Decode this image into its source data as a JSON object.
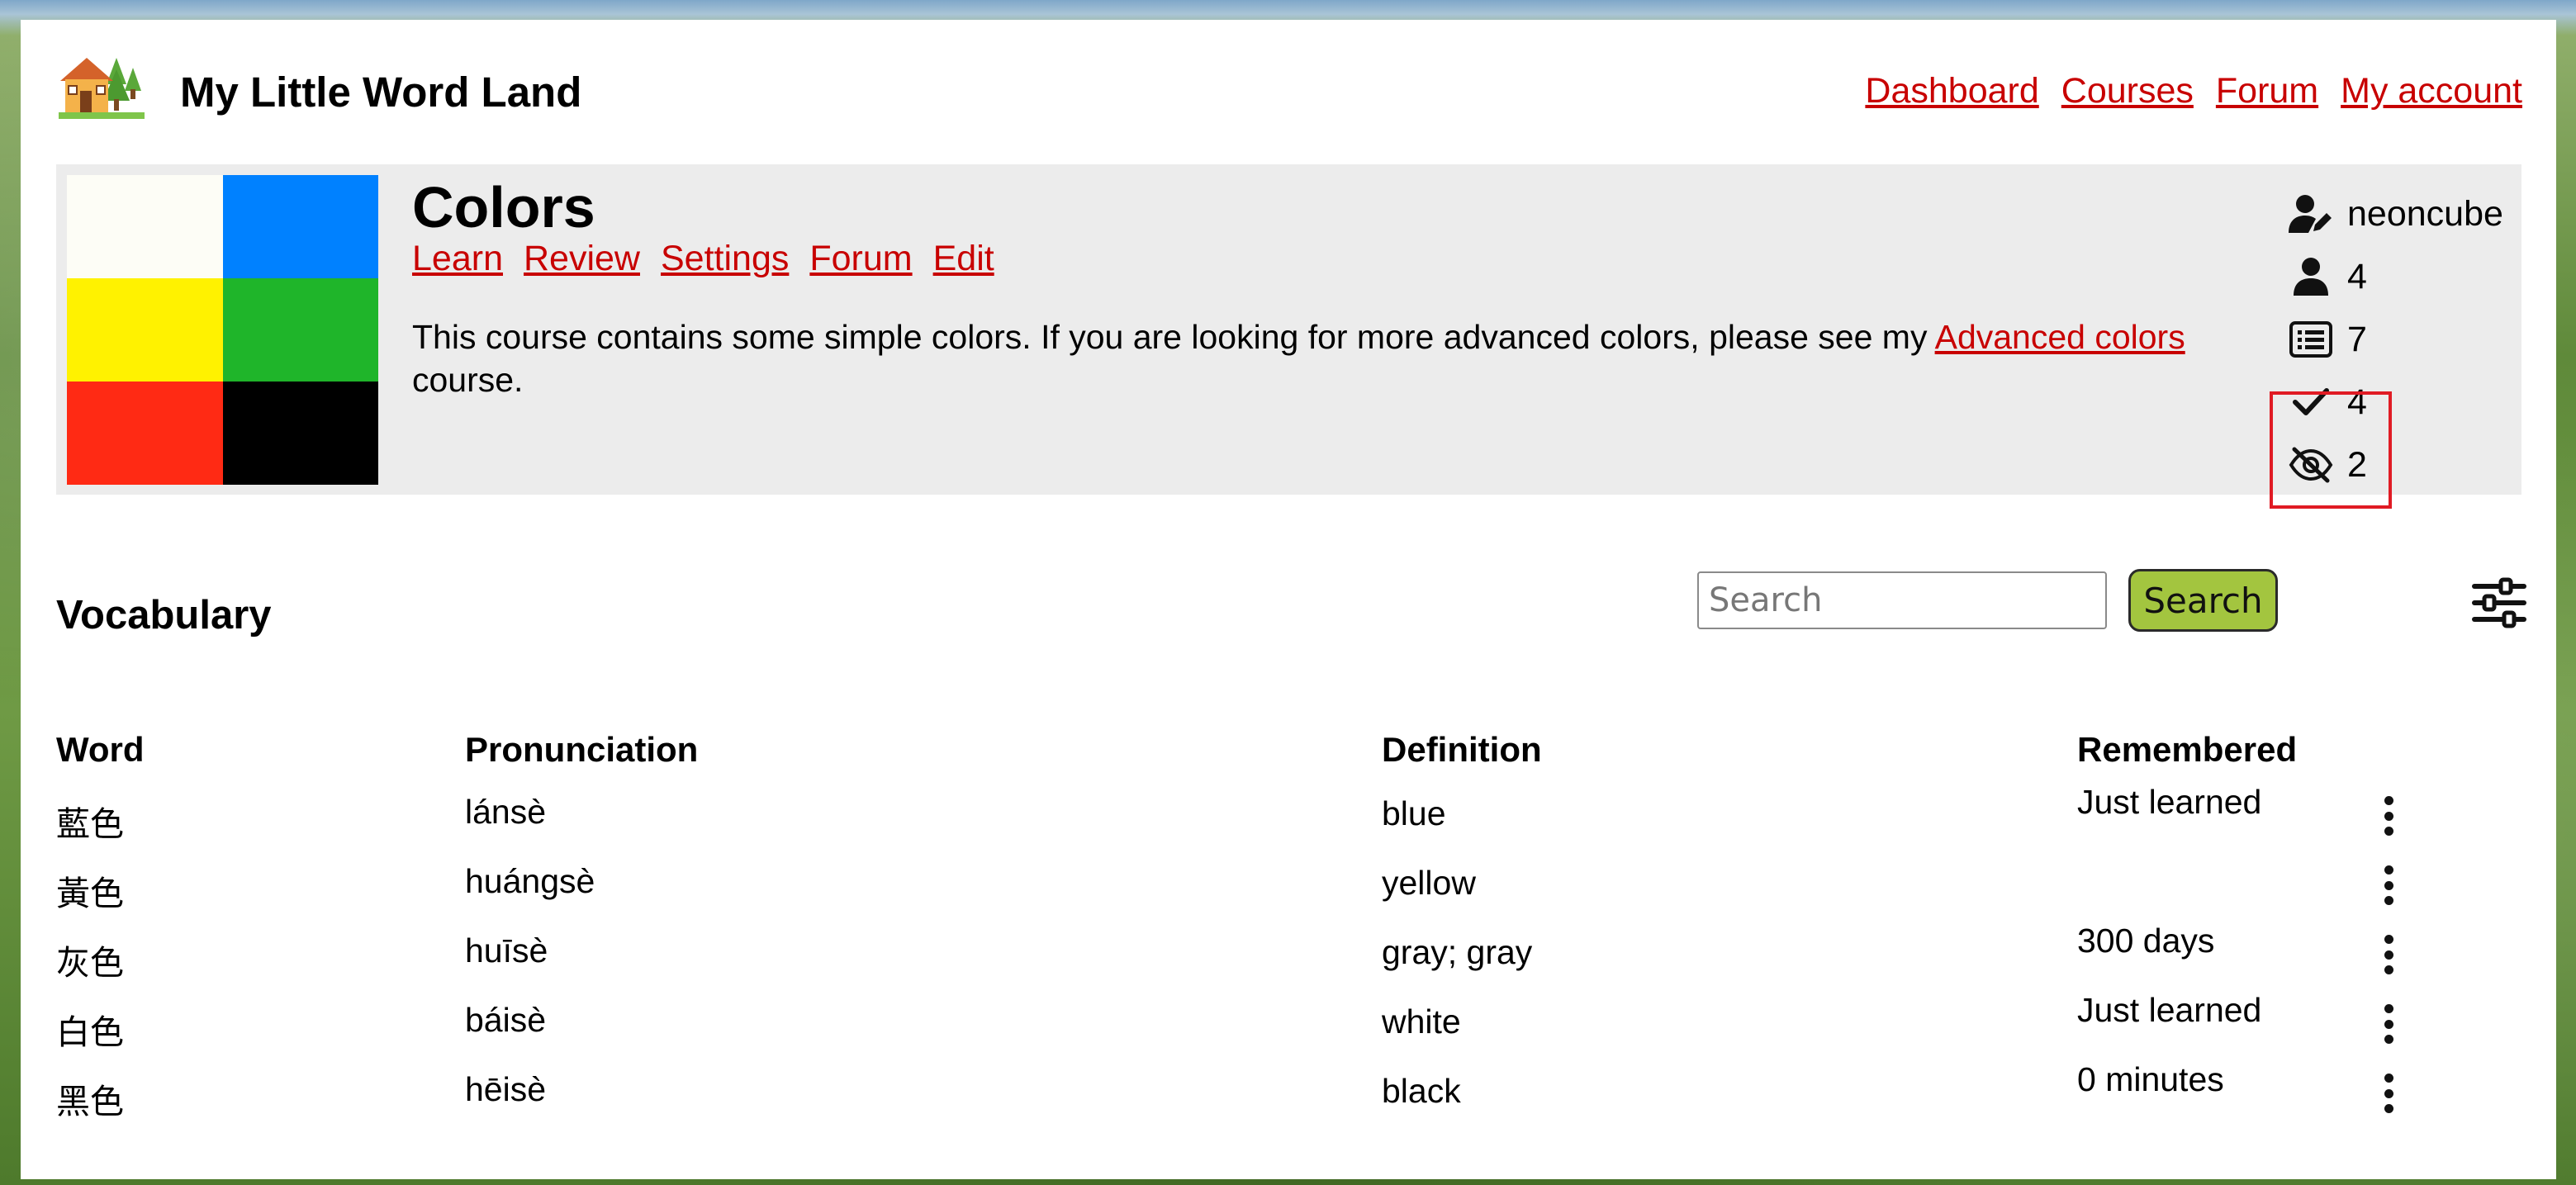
{
  "site": {
    "title": "My Little Word Land",
    "logo_icon": "house-with-trees-logo"
  },
  "topnav": [
    "Dashboard",
    "Courses",
    "Forum",
    "My account"
  ],
  "course": {
    "title": "Colors",
    "links": [
      "Learn",
      "Review",
      "Settings",
      "Forum",
      "Edit"
    ],
    "description_before": "This course contains some simple colors. If you are looking for more advanced colors, please see my ",
    "description_link": "Advanced colors",
    "description_after": " course.",
    "swatches": [
      "#fdfdf6",
      "#0081ff",
      "#fff200",
      "#1fb52a",
      "#ff2a14",
      "#000000"
    ],
    "stats": {
      "author": "neoncube",
      "learners": "4",
      "words": "7",
      "learned": "4",
      "ignored": "2"
    }
  },
  "vocabulary": {
    "heading": "Vocabulary",
    "search_placeholder": "Search",
    "search_button": "Search",
    "columns": [
      "Word",
      "Pronunciation",
      "Definition",
      "Remembered"
    ],
    "rows": [
      {
        "word": "藍色",
        "pronunciation": "lánsè",
        "definition": "blue",
        "remembered": "Just learned"
      },
      {
        "word": "黃色",
        "pronunciation": "huángsè",
        "definition": "yellow",
        "remembered": ""
      },
      {
        "word": "灰色",
        "pronunciation": "huīsè",
        "definition": "gray; gray",
        "remembered": "300 days"
      },
      {
        "word": "白色",
        "pronunciation": "báisè",
        "definition": "white",
        "remembered": "Just learned"
      },
      {
        "word": "黑色",
        "pronunciation": "hēisè",
        "definition": "black",
        "remembered": "0 minutes"
      }
    ]
  },
  "colors": {
    "link": "#c80000",
    "card_bg": "#ececec",
    "search_button_bg": "#a3c53f",
    "highlight_box": "#e01b24"
  }
}
